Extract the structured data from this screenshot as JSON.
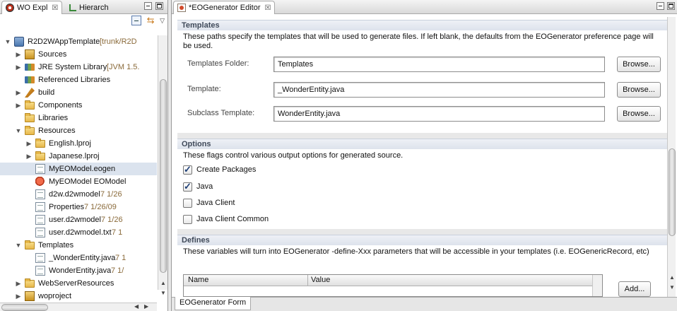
{
  "left_pane": {
    "tabs": [
      {
        "label": "WO Expl",
        "close": "☒"
      },
      {
        "label": "Hierarch"
      }
    ],
    "tree": [
      {
        "label": "R2D2WAppTemplate",
        "suffix": " [trunk/R2D",
        "depth": 0,
        "arrow": "▼",
        "icon": "project-icon"
      },
      {
        "label": "Sources",
        "depth": 1,
        "arrow": "▶",
        "icon": "package-folder-icon"
      },
      {
        "label": "JRE System Library",
        "suffix": " [JVM 1.5.",
        "depth": 1,
        "arrow": "▶",
        "icon": "library-icon"
      },
      {
        "label": "Referenced Libraries",
        "depth": 1,
        "arrow": "",
        "icon": "library-icon"
      },
      {
        "label": "build",
        "depth": 1,
        "arrow": "▶",
        "icon": "build-icon"
      },
      {
        "label": "Components",
        "depth": 1,
        "arrow": "▶",
        "icon": "folder-icon"
      },
      {
        "label": "Libraries",
        "depth": 1,
        "arrow": "",
        "icon": "folder-icon"
      },
      {
        "label": "Resources",
        "depth": 1,
        "arrow": "▼",
        "icon": "folder-icon"
      },
      {
        "label": "English.lproj",
        "depth": 2,
        "arrow": "▶",
        "icon": "folder-icon"
      },
      {
        "label": "Japanese.lproj",
        "depth": 2,
        "arrow": "▶",
        "icon": "folder-icon"
      },
      {
        "label": "MyEOModel.eogen",
        "depth": 2,
        "arrow": "",
        "icon": "eogen-file-icon",
        "selected": true
      },
      {
        "label": "MyEOModel EOModel",
        "depth": 2,
        "arrow": "",
        "icon": "eomodel-icon"
      },
      {
        "label": "d2w.d2wmodel",
        "suffix": " 7  1/26",
        "depth": 2,
        "arrow": "",
        "icon": "file-icon"
      },
      {
        "label": "Properties",
        "suffix": " 7  1/26/09",
        "depth": 2,
        "arrow": "",
        "icon": "file-icon"
      },
      {
        "label": "user.d2wmodel",
        "suffix": " 7  1/26",
        "depth": 2,
        "arrow": "",
        "icon": "file-icon"
      },
      {
        "label": "user.d2wmodel.txt",
        "suffix": " 7  1",
        "depth": 2,
        "arrow": "",
        "icon": "file-icon"
      },
      {
        "label": "Templates",
        "depth": 1,
        "arrow": "▼",
        "icon": "folder-icon"
      },
      {
        "label": "_WonderEntity.java",
        "suffix": " 7  1",
        "depth": 2,
        "arrow": "",
        "icon": "file-icon"
      },
      {
        "label": "WonderEntity.java",
        "suffix": " 7  1/",
        "depth": 2,
        "arrow": "",
        "icon": "file-icon"
      },
      {
        "label": "WebServerResources",
        "depth": 1,
        "arrow": "▶",
        "icon": "folder-icon"
      },
      {
        "label": "woproject",
        "depth": 1,
        "arrow": "▶",
        "icon": "package-folder-icon"
      }
    ]
  },
  "editor": {
    "tab_label": "*EOGenerator Editor",
    "close": "☒",
    "templates": {
      "heading": "Templates",
      "description": "These paths specify the templates that will be used to generate files.  If left blank, the defaults from the EOGenerator preference page will be used.",
      "fields": [
        {
          "label": "Templates Folder:",
          "value": "Templates",
          "button": "Browse..."
        },
        {
          "label": "Template:",
          "value": "_WonderEntity.java",
          "button": "Browse..."
        },
        {
          "label": "Subclass Template:",
          "value": "WonderEntity.java",
          "button": "Browse..."
        }
      ]
    },
    "options": {
      "heading": "Options",
      "description": "These flags control various output options for generated source.",
      "checkboxes": [
        {
          "label": "Create Packages",
          "checked": true
        },
        {
          "label": "Java",
          "checked": true
        },
        {
          "label": "Java Client",
          "checked": false
        },
        {
          "label": "Java Client Common",
          "checked": false
        }
      ]
    },
    "defines": {
      "heading": "Defines",
      "description": "These variables will turn into EOGenerator -define-Xxx parameters that will be accessible in your templates (i.e. EOGenericRecord, etc)",
      "columns": [
        "Name",
        "Value"
      ],
      "add_button": "Add..."
    },
    "bottom_tab": "EOGenerator Form"
  }
}
